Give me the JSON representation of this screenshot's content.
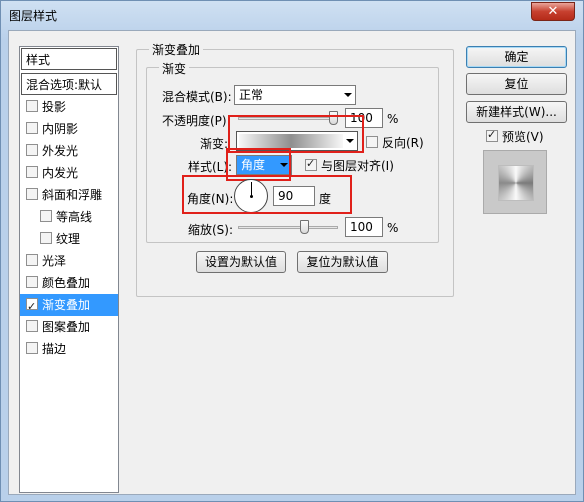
{
  "window": {
    "title": "图层样式",
    "close_glyph": "✕"
  },
  "style_list": {
    "header": "样式",
    "blend_defaults": "混合选项:默认",
    "items": [
      {
        "label": "投影",
        "checked": false
      },
      {
        "label": "内阴影",
        "checked": false
      },
      {
        "label": "外发光",
        "checked": false
      },
      {
        "label": "内发光",
        "checked": false
      },
      {
        "label": "斜面和浮雕",
        "checked": false
      },
      {
        "label": "等高线",
        "checked": false
      },
      {
        "label": "纹理",
        "checked": false
      },
      {
        "label": "光泽",
        "checked": false
      },
      {
        "label": "颜色叠加",
        "checked": false
      },
      {
        "label": "渐变叠加",
        "checked": true
      },
      {
        "label": "图案叠加",
        "checked": false
      },
      {
        "label": "描边",
        "checked": false
      }
    ]
  },
  "gradient_overlay": {
    "outer_title": "渐变叠加",
    "inner_title": "渐变",
    "blend_mode_label": "混合模式(B):",
    "blend_mode_value": "正常",
    "opacity_label": "不透明度(P):",
    "opacity_value": "100",
    "opacity_unit": "%",
    "opacity_level_percent": 100,
    "gradient_label": "渐变:",
    "reverse_label": "反向(R)",
    "reverse_checked": false,
    "style_label": "样式(L):",
    "style_value": "角度",
    "align_label": "与图层对齐(I)",
    "align_checked": true,
    "angle_label": "角度(N):",
    "angle_value": "90",
    "angle_unit": "度",
    "scale_label": "缩放(S):",
    "scale_value": "100",
    "scale_unit": "%",
    "scale_level_percent": 100,
    "make_default_label": "设置为默认值",
    "reset_default_label": "复位为默认值"
  },
  "buttons": {
    "ok": "确定",
    "reset": "复位",
    "new_style": "新建样式(W)...",
    "preview_label": "预览(V)",
    "preview_checked": true
  },
  "colors": {
    "selection": "#3399ff",
    "highlight_box": "#e0201a"
  }
}
